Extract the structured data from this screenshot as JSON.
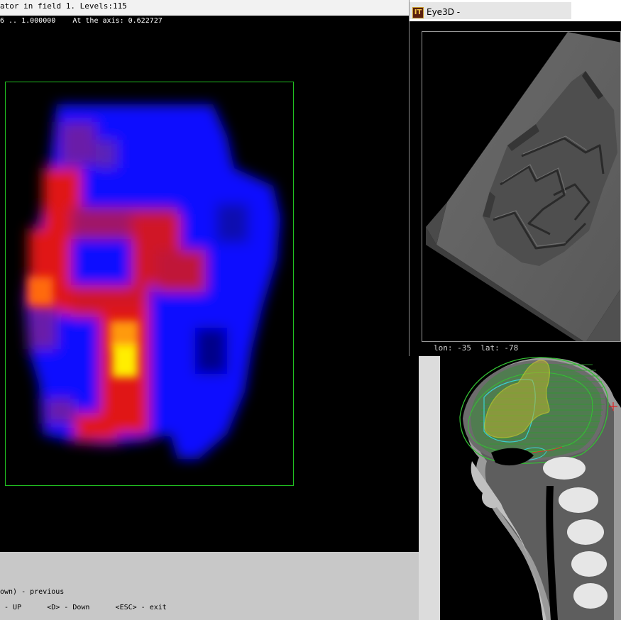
{
  "map_window": {
    "title": "ator in field 1. Levels:115",
    "range_text": "6 .. 1.000000    At the axis: 0.622727",
    "help_line_1": "own) - previous",
    "help_line_2": " - UP      <D> - Down      <ESC> - exit"
  },
  "eye3d": {
    "title": "Eye3D -",
    "app_icon": "IT",
    "lon_label": "lon:",
    "lon_value": "-35",
    "lat_label": "lat:",
    "lat_value": "-78"
  },
  "colors": {
    "field_frame": "#21c021",
    "colormap": [
      "#0000ff",
      "#6a18a8",
      "#e41e1e",
      "#ff6a10",
      "#ffee00"
    ]
  }
}
